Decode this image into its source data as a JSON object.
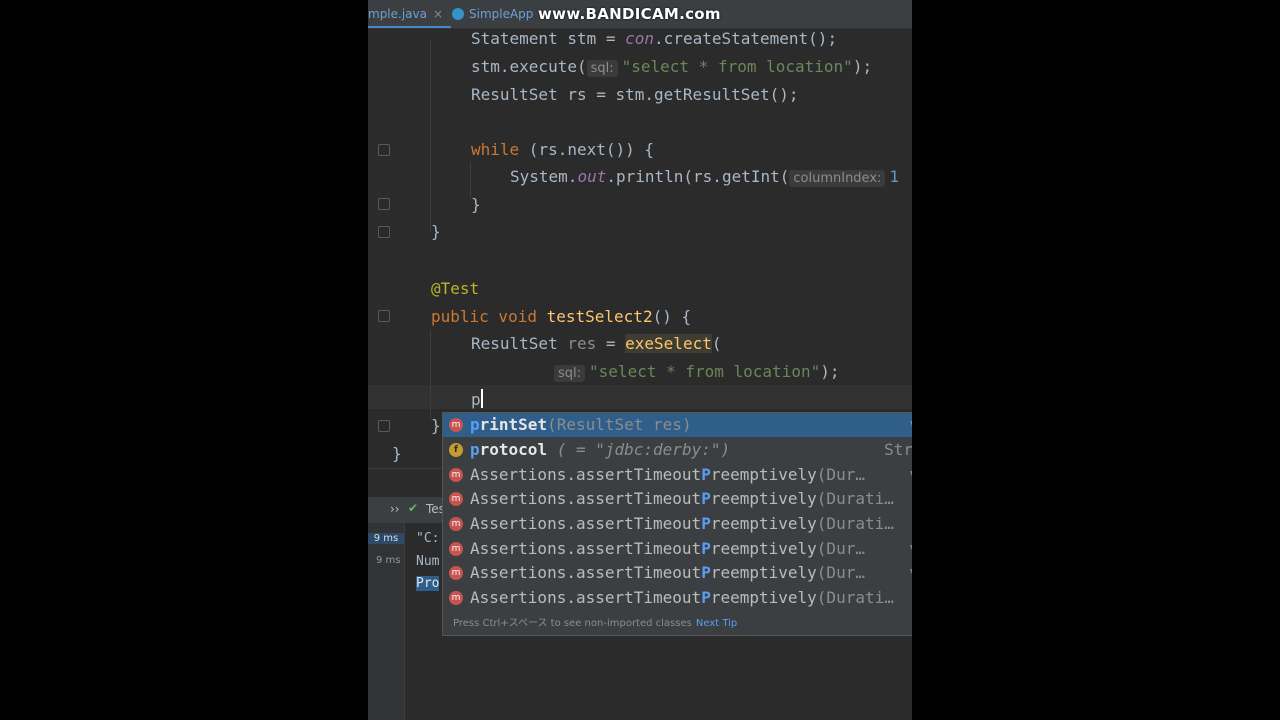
{
  "tabs": [
    {
      "label": "mple.java",
      "close": "×"
    },
    {
      "label": "SimpleApp",
      "icon": "class-icon",
      "close": "×"
    }
  ],
  "watermark": "www.BANDICAM.com",
  "code": {
    "l1": {
      "type": "Statement",
      "var": " stm = ",
      "field": "con",
      "rest": ".createStatement();"
    },
    "l2": {
      "a": "stm.execute(",
      "hint": "sql:",
      "str": "\"select * from location\"",
      "b": ");"
    },
    "l3": "ResultSet rs = stm.getResultSet();",
    "l4": {
      "kw": "while",
      "rest": " (rs.next()) {"
    },
    "l5": {
      "a": "System.",
      "field": "out",
      "b": ".println(rs.getInt(",
      "hint": "columnIndex:",
      "c": "1"
    },
    "l6": "}",
    "l7": "}",
    "l8": "@Test",
    "l9": {
      "kw1": "public",
      "kw2": " void",
      "fn": "testSelect2",
      "rest": "() {"
    },
    "l10": {
      "a": "ResultSet ",
      "unused": "res",
      "b": " = ",
      "fn": "exeSelect",
      "c": "("
    },
    "l11": {
      "hint": "sql:",
      "str": "\"select * from location\"",
      "b": ");"
    },
    "l12": "p",
    "l13": "}",
    "l14": "}"
  },
  "completion": {
    "items": [
      {
        "match": "p",
        "rest": "rintSet",
        "sig": "(ResultSet res)",
        "right": "v",
        "icon": "method-icon",
        "icon_letter": "m"
      },
      {
        "match": "p",
        "rest": "rotocol",
        "sig": " ( = \"jdbc:derby:\")",
        "right": "Str",
        "icon": "field-icon",
        "icon_letter": "f"
      },
      {
        "pre": "Assertions.assertTimeout",
        "match": "P",
        "rest": "reemptively",
        "sig": "(Dur…",
        "right": "v",
        "icon": "method-icon",
        "icon_letter": "m"
      },
      {
        "pre": "Assertions.assertTimeout",
        "match": "P",
        "rest": "reemptively",
        "sig": "(Durati…",
        "right": "",
        "icon": "method-icon",
        "icon_letter": "m"
      },
      {
        "pre": "Assertions.assertTimeout",
        "match": "P",
        "rest": "reemptively",
        "sig": "(Durati…",
        "right": "",
        "icon": "method-icon",
        "icon_letter": "m"
      },
      {
        "pre": "Assertions.assertTimeout",
        "match": "P",
        "rest": "reemptively",
        "sig": "(Dur…",
        "right": "v",
        "icon": "method-icon",
        "icon_letter": "m"
      },
      {
        "pre": "Assertions.assertTimeout",
        "match": "P",
        "rest": "reemptively",
        "sig": "(Dur…",
        "right": "v",
        "icon": "method-icon",
        "icon_letter": "m"
      },
      {
        "pre": "Assertions.assertTimeout",
        "match": "P",
        "rest": "reemptively",
        "sig": "(Durati…",
        "right": "",
        "icon": "method-icon",
        "icon_letter": "m"
      }
    ],
    "footer": "Press Ctrl+スペース to see non-imported classes",
    "next_tip": "Next Tip"
  },
  "run_panel": {
    "expand": "››",
    "check": "✔",
    "tab": "Tes",
    "times": [
      "9 ms",
      "9 ms"
    ],
    "console": [
      "\"C:",
      "Num",
      "Pro"
    ]
  },
  "colors": {
    "keyword": "#cc7832",
    "function": "#ffc66d",
    "string": "#6a8759",
    "annotation": "#bbb529",
    "selection": "#2f5e8a"
  }
}
